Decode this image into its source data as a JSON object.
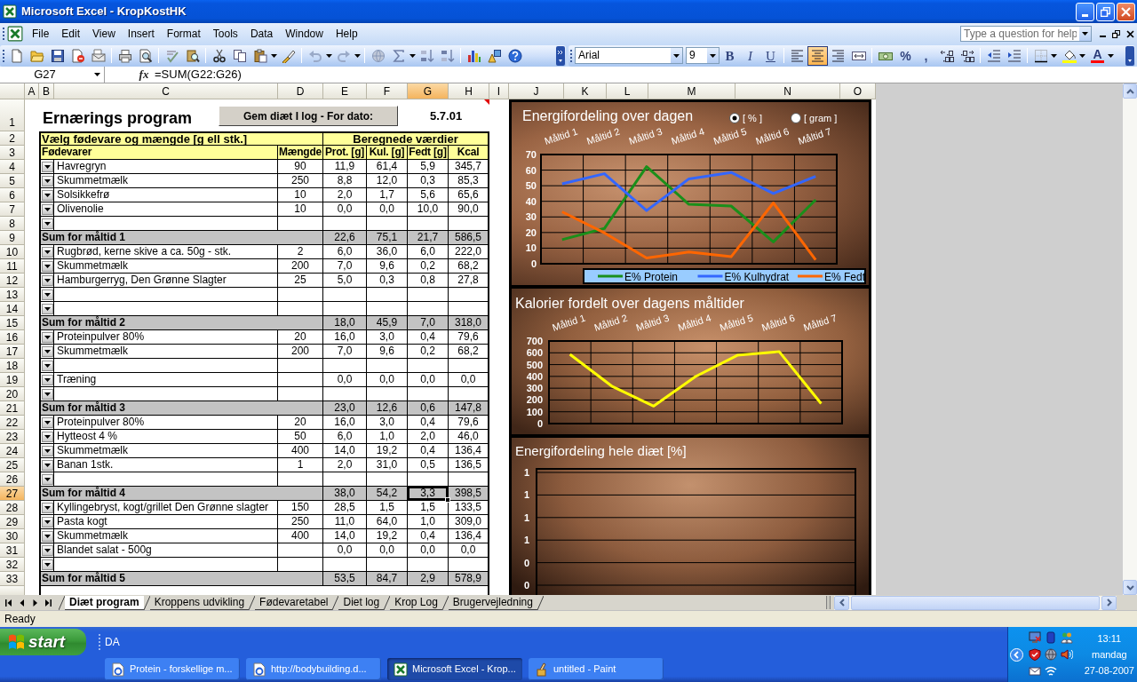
{
  "window": {
    "title": "Microsoft Excel - KropKostHK"
  },
  "menu": {
    "items": [
      "File",
      "Edit",
      "View",
      "Insert",
      "Format",
      "Tools",
      "Data",
      "Window",
      "Help"
    ],
    "help_box": {
      "placeholder": "Type a question for help"
    }
  },
  "formatting": {
    "font": "Arial",
    "size": "9",
    "style_buttons": [
      "B",
      "I",
      "U"
    ],
    "alignment": [
      {
        "kind": "left",
        "selected": false
      },
      {
        "kind": "center",
        "selected": true
      },
      {
        "kind": "right",
        "selected": false
      }
    ],
    "number_buttons": [
      "%",
      ","
    ],
    "font_color_button": "A"
  },
  "formula_bar": {
    "name_box": "G27",
    "function_button": "fx",
    "formula": "=SUM(G22:G26)"
  },
  "sheet": {
    "columns": [
      {
        "label": "A",
        "selected": false
      },
      {
        "label": "B",
        "selected": false
      },
      {
        "label": "C",
        "selected": false
      },
      {
        "label": "D",
        "selected": false
      },
      {
        "label": "E",
        "selected": false
      },
      {
        "label": "F",
        "selected": false
      },
      {
        "label": "G",
        "selected": true
      },
      {
        "label": "H",
        "selected": false
      },
      {
        "label": "I",
        "selected": false
      },
      {
        "label": "J",
        "selected": false
      },
      {
        "label": "K",
        "selected": false
      },
      {
        "label": "L",
        "selected": false
      },
      {
        "label": "M",
        "selected": false
      },
      {
        "label": "N",
        "selected": false
      },
      {
        "label": "O",
        "selected": false
      }
    ],
    "title_row": {
      "number": "1",
      "title": "Ernærings program",
      "button": "Gem diæt I log - For dato:",
      "date": "5.7.01"
    },
    "group_row": {
      "number": "2",
      "groups": [
        "Vælg fødevare og mængde [g ell stk.]",
        "Beregnede værdier"
      ]
    },
    "header_row": {
      "number": "3",
      "labels": [
        "Fødevarer",
        "Mængde",
        "Prot. [g]",
        "Kul. [g]",
        "Fedt [g]",
        "Kcal"
      ]
    },
    "rows": [
      {
        "number": "4",
        "kind": "item",
        "selected": false,
        "food": "Havregryn",
        "amount": "90",
        "values": [
          "11,9",
          "61,4",
          "5,9",
          "345,7"
        ]
      },
      {
        "number": "5",
        "kind": "item",
        "selected": false,
        "food": "Skummetmælk",
        "amount": "250",
        "values": [
          "8,8",
          "12,0",
          "0,3",
          "85,3"
        ]
      },
      {
        "number": "6",
        "kind": "item",
        "selected": false,
        "food": "Solsikkefrø",
        "amount": "10",
        "values": [
          "2,0",
          "1,7",
          "5,6",
          "65,6"
        ]
      },
      {
        "number": "7",
        "kind": "item",
        "selected": false,
        "food": "Olivenolie",
        "amount": "10",
        "values": [
          "0,0",
          "0,0",
          "10,0",
          "90,0"
        ]
      },
      {
        "number": "8",
        "kind": "item",
        "selected": false
      },
      {
        "number": "9",
        "kind": "sum",
        "selected": false,
        "label": "Sum for måltid 1",
        "values": [
          "22,6",
          "75,1",
          "21,7",
          "586,5"
        ]
      },
      {
        "number": "10",
        "kind": "item",
        "selected": false,
        "food": "Rugbrød, kerne skive a ca. 50g - stk.",
        "amount": "2",
        "values": [
          "6,0",
          "36,0",
          "6,0",
          "222,0"
        ]
      },
      {
        "number": "11",
        "kind": "item",
        "selected": false,
        "food": "Skummetmælk",
        "amount": "200",
        "values": [
          "7,0",
          "9,6",
          "0,2",
          "68,2"
        ]
      },
      {
        "number": "12",
        "kind": "item",
        "selected": false,
        "food": "Hamburgerryg, Den Grønne Slagter",
        "amount": "25",
        "values": [
          "5,0",
          "0,3",
          "0,8",
          "27,8"
        ]
      },
      {
        "number": "13",
        "kind": "item",
        "selected": false
      },
      {
        "number": "14",
        "kind": "item",
        "selected": false
      },
      {
        "number": "15",
        "kind": "sum",
        "selected": false,
        "label": "Sum for måltid 2",
        "values": [
          "18,0",
          "45,9",
          "7,0",
          "318,0"
        ]
      },
      {
        "number": "16",
        "kind": "item",
        "selected": false,
        "food": "Proteinpulver 80%",
        "amount": "20",
        "values": [
          "16,0",
          "3,0",
          "0,4",
          "79,6"
        ]
      },
      {
        "number": "17",
        "kind": "item",
        "selected": false,
        "food": "Skummetmælk",
        "amount": "200",
        "values": [
          "7,0",
          "9,6",
          "0,2",
          "68,2"
        ]
      },
      {
        "number": "18",
        "kind": "item",
        "selected": false
      },
      {
        "number": "19",
        "kind": "item",
        "selected": false,
        "food": "Træning",
        "values": [
          "0,0",
          "0,0",
          "0,0",
          "0,0"
        ]
      },
      {
        "number": "20",
        "kind": "item",
        "selected": false
      },
      {
        "number": "21",
        "kind": "sum",
        "selected": false,
        "label": "Sum for måltid 3",
        "values": [
          "23,0",
          "12,6",
          "0,6",
          "147,8"
        ]
      },
      {
        "number": "22",
        "kind": "item",
        "selected": false,
        "food": "Proteinpulver 80%",
        "amount": "20",
        "values": [
          "16,0",
          "3,0",
          "0,4",
          "79,6"
        ]
      },
      {
        "number": "23",
        "kind": "item",
        "selected": false,
        "food": "Hytteost 4 %",
        "amount": "50",
        "values": [
          "6,0",
          "1,0",
          "2,0",
          "46,0"
        ]
      },
      {
        "number": "24",
        "kind": "item",
        "selected": false,
        "food": "Skummetmælk",
        "amount": "400",
        "values": [
          "14,0",
          "19,2",
          "0,4",
          "136,4"
        ]
      },
      {
        "number": "25",
        "kind": "item",
        "selected": false,
        "food": "Banan 1stk.",
        "amount": "1",
        "values": [
          "2,0",
          "31,0",
          "0,5",
          "136,5"
        ]
      },
      {
        "number": "26",
        "kind": "item",
        "selected": false
      },
      {
        "number": "27",
        "kind": "sum",
        "selected": true,
        "label": "Sum for måltid 4",
        "values": [
          "38,0",
          "54,2",
          "3,3",
          "398,5"
        ]
      },
      {
        "number": "28",
        "kind": "item",
        "selected": false,
        "food": "Kyllingebryst, kogt/grillet Den Grønne slagter",
        "amount": "150",
        "values": [
          "28,5",
          "1,5",
          "1,5",
          "133,5"
        ]
      },
      {
        "number": "29",
        "kind": "item",
        "selected": false,
        "food": "Pasta kogt",
        "amount": "250",
        "values": [
          "11,0",
          "64,0",
          "1,0",
          "309,0"
        ]
      },
      {
        "number": "30",
        "kind": "item",
        "selected": false,
        "food": "Skummetmælk",
        "amount": "400",
        "values": [
          "14,0",
          "19,2",
          "0,4",
          "136,4"
        ]
      },
      {
        "number": "31",
        "kind": "item",
        "selected": false,
        "food": "Blandet salat - 500g",
        "values": [
          "0,0",
          "0,0",
          "0,0",
          "0,0"
        ]
      },
      {
        "number": "32",
        "kind": "item",
        "selected": false
      },
      {
        "number": "33",
        "kind": "sum",
        "selected": false,
        "label": "Sum for måltid 5",
        "values": [
          "53,5",
          "84,7",
          "2,9",
          "578,9"
        ]
      }
    ]
  },
  "charts": [
    {
      "title": "Energifordeling over dagen",
      "options": [
        {
          "label": "[ % ]",
          "selected": true
        },
        {
          "label": "[ gram ]",
          "selected": false
        }
      ],
      "chart_data": {
        "type": "line",
        "categories": [
          "Måltid 1",
          "Måltid 2",
          "Måltid 3",
          "Måltid 4",
          "Måltid 5",
          "Måltid 6",
          "Måltid 7"
        ],
        "series": [
          {
            "name": "E% Protein",
            "color": "#1a8f1a",
            "values": [
              15.4,
              22.6,
              62.2,
              38.1,
              37.0,
              14.0,
              41.0
            ]
          },
          {
            "name": "E% Kulhydrat",
            "color": "#3366ff",
            "values": [
              51.2,
              57.7,
              34.1,
              54.4,
              58.5,
              45.0,
              56.0
            ]
          },
          {
            "name": "E% Fedt",
            "color": "#ff6600",
            "values": [
              33.3,
              19.8,
              3.7,
              7.5,
              4.5,
              39.0,
              2.5
            ]
          }
        ],
        "ylim": [
          0,
          70
        ],
        "yticks": [
          {
            "value": 0,
            "label": "0"
          },
          {
            "value": 10,
            "label": "10"
          },
          {
            "value": 20,
            "label": "20"
          },
          {
            "value": 30,
            "label": "30"
          },
          {
            "value": 40,
            "label": "40"
          },
          {
            "value": 50,
            "label": "50"
          },
          {
            "value": 60,
            "label": "60"
          },
          {
            "value": 70,
            "label": "70"
          }
        ],
        "grid": true,
        "legend": "bottom"
      }
    },
    {
      "title": "Kalorier fordelt over dagens måltider",
      "chart_data": {
        "type": "line",
        "categories": [
          "Måltid 1",
          "Måltid 2",
          "Måltid 3",
          "Måltid 4",
          "Måltid 5",
          "Måltid 6",
          "Måltid 7"
        ],
        "series": [
          {
            "color": "#ffff00",
            "values": [
              587,
              318,
              148,
              399,
              579,
              609,
              169
            ]
          }
        ],
        "ylim": [
          0,
          700
        ],
        "yticks": [
          {
            "value": 0,
            "label": "0"
          },
          {
            "value": 100,
            "label": "100"
          },
          {
            "value": 200,
            "label": "200"
          },
          {
            "value": 300,
            "label": "300"
          },
          {
            "value": 400,
            "label": "400"
          },
          {
            "value": 500,
            "label": "500"
          },
          {
            "value": 600,
            "label": "600"
          },
          {
            "value": 700,
            "label": "700"
          }
        ],
        "grid": true
      }
    },
    {
      "title": "Energifordeling hele diæt [%]",
      "axis_labels": [
        "1",
        "1",
        "1",
        "1",
        "0",
        "0"
      ]
    }
  ],
  "sheet_tabs": [
    {
      "label": "Diæt program",
      "selected": true
    },
    {
      "label": "Kroppens udvikling",
      "selected": false
    },
    {
      "label": "Fødevaretabel",
      "selected": false
    },
    {
      "label": "Diet log",
      "selected": false
    },
    {
      "label": "Krop Log",
      "selected": false
    },
    {
      "label": "Brugervejledning",
      "selected": false
    }
  ],
  "status_bar": {
    "text": "Ready"
  },
  "taskbar": {
    "start": "start",
    "language": "DA",
    "tasks": [
      {
        "kind": "browser",
        "label": "Protein - forskellige m...",
        "selected": false
      },
      {
        "kind": "browser",
        "label": "http://bodybuilding.d...",
        "selected": false
      },
      {
        "kind": "spreadsheet",
        "label": "Microsoft Excel - Krop...",
        "selected": true
      },
      {
        "kind": "paint",
        "label": "untitled - Paint",
        "selected": false
      }
    ],
    "clock": {
      "time": "13:11",
      "day": "mandag",
      "date": "27-08-2007"
    }
  }
}
